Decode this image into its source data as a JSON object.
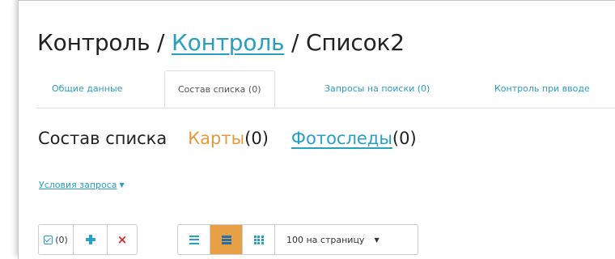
{
  "header": {
    "crumb_root": "Контроль",
    "sep1": " / ",
    "crumb_link": "Контроль",
    "sep2": " / ",
    "crumb_current": "Список2"
  },
  "tabs": [
    {
      "label": "Общие данные",
      "active": false
    },
    {
      "label": "Состав списка (0)",
      "active": true
    },
    {
      "label": "Запросы на поиски (0)",
      "active": false
    },
    {
      "label": "Контроль при вводе",
      "active": false
    }
  ],
  "section": {
    "title": "Состав списка",
    "cards_label": "Карты",
    "cards_count": "(0)",
    "photos_label": "Фотоследы",
    "photos_count": "(0)"
  },
  "query": {
    "label": "Условия запроса"
  },
  "toolbar": {
    "selected_count": "(0)",
    "page_size_label": "100 на страницу",
    "active_view": "table"
  },
  "colors": {
    "accent_blue": "#2a9fc4",
    "accent_orange": "#e59a3c",
    "active_button": "#e7a045",
    "delete_red": "#c9302c"
  },
  "icons": [
    "checkbox-icon",
    "plus-icon",
    "close-icon",
    "list-view-icon",
    "table-view-icon",
    "grid-view-icon",
    "caret-down-icon"
  ]
}
